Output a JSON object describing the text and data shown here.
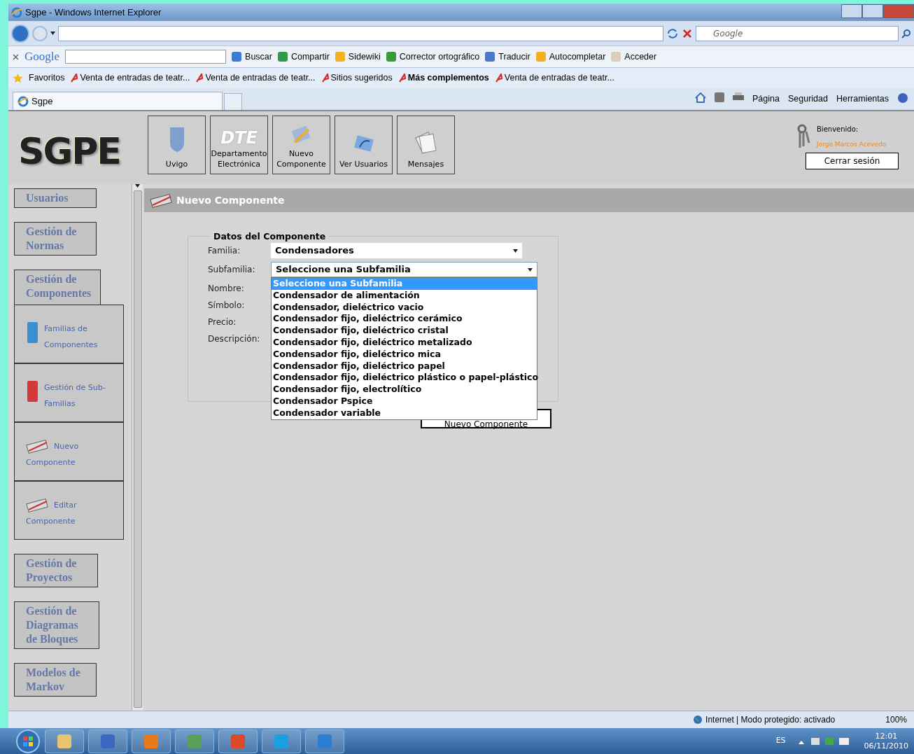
{
  "window": {
    "title": "Sgpe - Windows Internet Explorer"
  },
  "search_box": {
    "placeholder": "Google"
  },
  "google_toolbar": {
    "logo": "Google",
    "items": [
      {
        "label": "Buscar",
        "color": "#3b7bd8"
      },
      {
        "label": "Compartir",
        "color": "#2f9a4a"
      },
      {
        "label": "Sidewiki",
        "color": "#f0b020"
      },
      {
        "label": "Corrector ortográfico",
        "color": "#3a9a3a"
      },
      {
        "label": "Traducir",
        "color": "#4a78c8"
      },
      {
        "label": "Autocompletar",
        "color": "#f0b020"
      },
      {
        "label": "Acceder",
        "color": "#d8d0b8"
      }
    ]
  },
  "favorites_bar": {
    "label": "Favoritos",
    "items": [
      {
        "label": "Venta de entradas de teatr...",
        "bold": false
      },
      {
        "label": "Venta de entradas de teatr...",
        "bold": false
      },
      {
        "label": "Sitios sugeridos",
        "bold": false
      },
      {
        "label": "Más complementos",
        "bold": true
      },
      {
        "label": "Venta de entradas de teatr...",
        "bold": false
      }
    ]
  },
  "tabs": [
    {
      "label": "Sgpe",
      "selected": true
    }
  ],
  "command_bar": [
    "Página",
    "Seguridad",
    "Herramientas"
  ],
  "app": {
    "logo": "SGPE",
    "header_buttons": [
      {
        "kind": "shield",
        "label": "Uvigo"
      },
      {
        "kind": "dte",
        "logo": "DTE",
        "label": "Departamento Electrónica"
      },
      {
        "kind": "pencil",
        "label": "Nuevo Componente"
      },
      {
        "kind": "users",
        "label": "Ver Usuarios"
      },
      {
        "kind": "papers",
        "label": "Mensajes"
      }
    ],
    "user": {
      "greeting": "Bienvenido:",
      "name": "Jorge Marcos Acevedo",
      "logout": "Cerrar sesión"
    },
    "sidebar": [
      {
        "label": "Usuarios",
        "expanded": false
      },
      {
        "label": "Gestión de Normas",
        "expanded": false
      },
      {
        "label": "Gestión de Componentes",
        "expanded": true,
        "children": [
          {
            "kind": "book-blue",
            "label": "Familias de Componentes"
          },
          {
            "kind": "book-red",
            "label": "Gestión de Sub-Familias"
          },
          {
            "kind": "pencil",
            "label": "Nuevo Componente"
          },
          {
            "kind": "pencil",
            "label": "Editar Componente"
          }
        ]
      },
      {
        "label": "Gestión de Proyectos",
        "expanded": false
      },
      {
        "label": "Gestión de Diagramas de Bloques",
        "expanded": false
      },
      {
        "label": "Modelos de Markov",
        "expanded": false
      }
    ],
    "page_title": "Nuevo Componente",
    "form": {
      "legend": "Datos del Componente",
      "fields": [
        {
          "label": "Familia:",
          "kind": "select",
          "value": "Condensadores"
        },
        {
          "label": "Subfamilia:",
          "kind": "select",
          "value": "Seleccione una Subfamilia",
          "expanded": true,
          "options": [
            {
              "label": "Seleccione una Subfamilia",
              "selected": true
            },
            {
              "label": "Condensador de alimentación",
              "selected": false
            },
            {
              "label": "Condensador, dieléctrico vacio",
              "selected": false
            },
            {
              "label": "Condensador fijo, dieléctrico cerámico",
              "selected": false
            },
            {
              "label": "Condensador fijo, dieléctrico cristal",
              "selected": false
            },
            {
              "label": "Condensador fijo, dieléctrico metalizado",
              "selected": false
            },
            {
              "label": "Condensador fijo, dieléctrico mica",
              "selected": false
            },
            {
              "label": "Condensador fijo, dieléctrico papel",
              "selected": false
            },
            {
              "label": "Condensador fijo, dieléctrico plástico o papel-plástico",
              "selected": false
            },
            {
              "label": "Condensador fijo, electrolítico",
              "selected": false
            },
            {
              "label": "Condensador Pspice",
              "selected": false
            },
            {
              "label": "Condensador variable",
              "selected": false
            }
          ]
        },
        {
          "label": "Nombre:",
          "kind": "hidden"
        },
        {
          "label": "Símbolo:",
          "kind": "hidden"
        },
        {
          "label": "Precio:",
          "kind": "hidden"
        },
        {
          "label": "Descripción:",
          "kind": "hidden"
        }
      ],
      "submit": "Nuevo Componente"
    }
  },
  "status_bar": {
    "zone": "Internet | Modo protegido: activado",
    "zoom": "100%"
  },
  "taskbar": {
    "language": "ES",
    "time": "12:01",
    "date": "06/11/2010"
  }
}
